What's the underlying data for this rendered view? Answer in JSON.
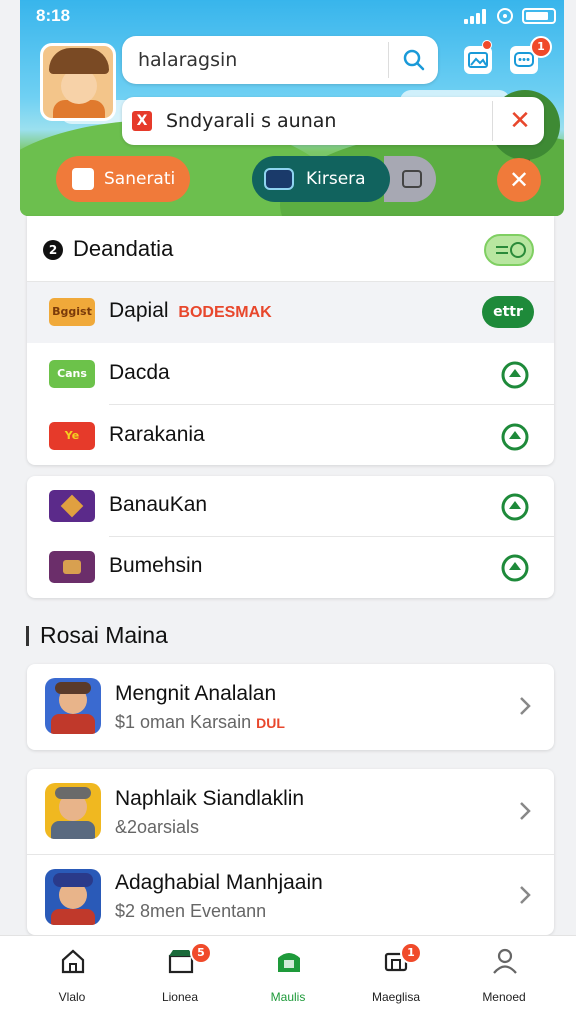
{
  "status_bar": {
    "time": "8:18"
  },
  "header": {
    "search_text": "halaragsin",
    "notification_text": "Sndyarali s aunan",
    "notification_icon": "X",
    "pills": {
      "orange": "Sanerati",
      "teal": "Kirsera"
    },
    "badges": {
      "right_button": "1"
    }
  },
  "section1": {
    "title": "Deandatia",
    "icon": "2",
    "rows": [
      {
        "title": "Dapial",
        "tag": "BODESMAK",
        "icon_label": "Bggist",
        "icon_color": "#f0a93a",
        "badge": "ettr"
      },
      {
        "title": "Dacda",
        "icon_label": "Cans",
        "icon_color": "#6cc24a"
      },
      {
        "title": "Rarakania",
        "icon_label": "Ye",
        "icon_color": "#e63a2a"
      }
    ]
  },
  "section2": {
    "rows": [
      {
        "title": "BanauKan",
        "icon_color": "#5b2a8a"
      },
      {
        "title": "Bumehsin",
        "icon_color": "#6b2e6a"
      }
    ]
  },
  "games_heading": "Rosai Maina",
  "games": [
    {
      "title": "Mengnit Analalan",
      "subtitle": "$1 oman Karsain",
      "tag": "DUL",
      "icon_bg": "#3a6ad0"
    },
    {
      "title": "Naphlaik Siandlaklin",
      "subtitle": "&2oarsials",
      "icon_bg": "#f0b820"
    },
    {
      "title": "Adaghabial Manhjaain",
      "subtitle": "$2 8men Eventann",
      "icon_bg": "#2a5ab8"
    }
  ],
  "bottom_nav": [
    {
      "label": "Vlalo",
      "icon": "home-icon",
      "badge": ""
    },
    {
      "label": "Lionea",
      "icon": "store-icon",
      "badge": "5"
    },
    {
      "label": "Maulis",
      "icon": "games-icon",
      "badge": "",
      "active": true
    },
    {
      "label": "Maeglisa",
      "icon": "messages-icon",
      "badge": "1"
    },
    {
      "label": "Menoed",
      "icon": "profile-icon",
      "badge": ""
    }
  ],
  "colors": {
    "accent_green": "#1e9a3a",
    "orange": "#f07a3a",
    "teal": "#11635e",
    "alert_red": "#e8472c"
  }
}
